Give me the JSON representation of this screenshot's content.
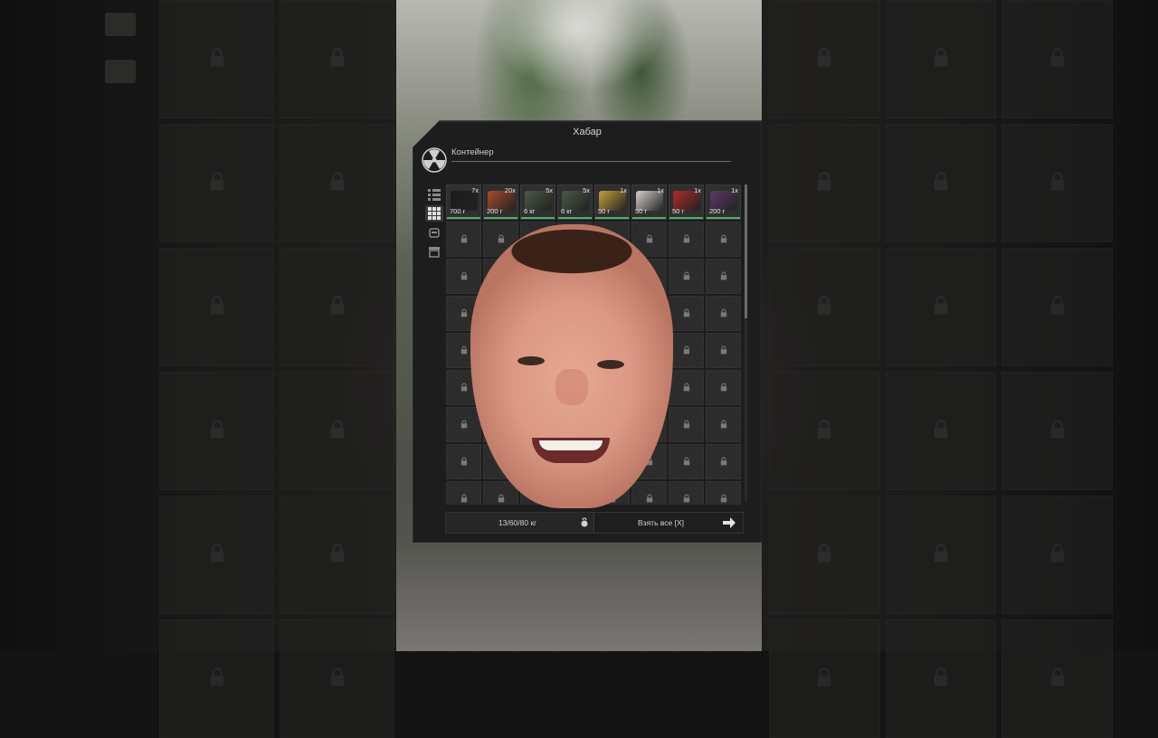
{
  "panel": {
    "title": "Хабар",
    "container_label": "Контейнер"
  },
  "items": [
    {
      "name": "item-1",
      "qty": "7x",
      "weight": "700 г",
      "color": "#1b1b1b"
    },
    {
      "name": "item-2",
      "qty": "20x",
      "weight": "200 г",
      "color": "#a84a2c"
    },
    {
      "name": "item-3",
      "qty": "5x",
      "weight": "6 кг",
      "color": "#4a5a44"
    },
    {
      "name": "item-4",
      "qty": "5x",
      "weight": "6 кг",
      "color": "#4a5a44"
    },
    {
      "name": "item-5",
      "qty": "1x",
      "weight": "50 г",
      "color": "#c4a03a"
    },
    {
      "name": "item-6",
      "qty": "1x",
      "weight": "50 г",
      "color": "#d8d0cc"
    },
    {
      "name": "item-7",
      "qty": "1x",
      "weight": "50 г",
      "color": "#b02a2a"
    },
    {
      "name": "item-8",
      "qty": "1x",
      "weight": "200 г",
      "color": "#5a3a6a"
    }
  ],
  "footer": {
    "weight": "13/60/80 кг",
    "take_all": "Взять все [X]"
  },
  "icons": {
    "panel": "radiation-icon",
    "tools": [
      "list-view-icon",
      "grid-view-icon",
      "backpack-icon",
      "box-icon"
    ],
    "lock": "lock-icon",
    "weight": "kettlebell-icon",
    "take": "arrow-right-icon"
  },
  "colors": {
    "panel_bg": "#1d1d1d",
    "slot_bg": "#2a2a2a",
    "accent_green": "#4fb06a"
  }
}
